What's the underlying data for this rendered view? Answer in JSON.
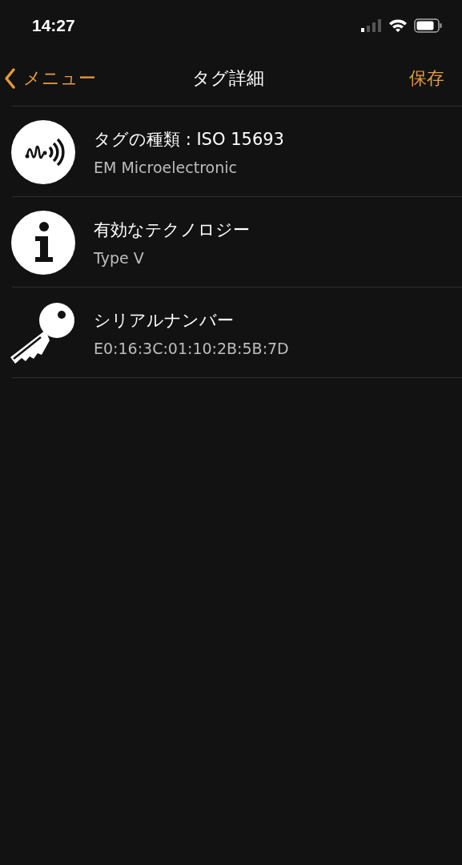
{
  "status_bar": {
    "time": "14:27"
  },
  "nav_bar": {
    "back_label": "メニュー",
    "title": "タグ詳細",
    "action": "保存"
  },
  "rows": [
    {
      "kind": "wave",
      "title": "タグの種類 : ISO 15693",
      "subtitle": "EM Microelectronic"
    },
    {
      "kind": "info",
      "title": "有効なテクノロジー",
      "subtitle": "Type V"
    },
    {
      "kind": "key",
      "title": "シリアルナンバー",
      "subtitle": "E0:16:3C:01:10:2B:5B:7D"
    }
  ]
}
